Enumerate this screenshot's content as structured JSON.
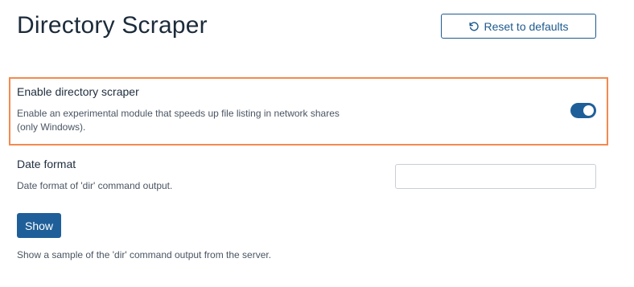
{
  "page": {
    "title": "Directory Scraper"
  },
  "header": {
    "reset_label": "Reset to defaults"
  },
  "settings": {
    "scraper": {
      "label": "Enable directory scraper",
      "description_line1": "Enable an experimental module that speeds up file listing in network shares",
      "description_line2": "(only Windows).",
      "enabled": true
    },
    "date_format": {
      "label": "Date format",
      "description": "Date format of 'dir' command output.",
      "value": "",
      "placeholder": ""
    },
    "sample": {
      "button_label": "Show",
      "description": "Show a sample of the 'dir' command output from the server."
    }
  },
  "colors": {
    "accent": "#1f5f99",
    "highlight_border": "#f4894f"
  },
  "icons": {
    "reset": "rotate-ccw-icon"
  }
}
